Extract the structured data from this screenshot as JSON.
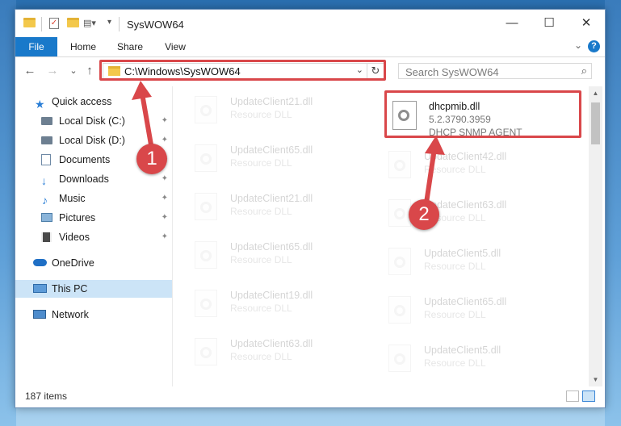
{
  "window": {
    "title": "SysWOW64",
    "minimize": "—",
    "maximize": "☐",
    "close": "✕"
  },
  "ribbon": {
    "tabs": [
      "File",
      "Home",
      "Share",
      "View"
    ],
    "collapse": "⌄",
    "help": "?"
  },
  "nav": {
    "back": "←",
    "forward": "→",
    "recent": "⌄",
    "up": "↑",
    "address": "C:\\Windows\\SysWOW64",
    "refresh": "↻",
    "search_placeholder": "Search SysWOW64"
  },
  "sidebar": {
    "items": [
      {
        "label": "Quick access",
        "icon": "star-icon",
        "pinned": false
      },
      {
        "label": "Local Disk (C:)",
        "icon": "drive-icon",
        "pinned": true
      },
      {
        "label": "Local Disk (D:)",
        "icon": "drive-icon",
        "pinned": true
      },
      {
        "label": "Documents",
        "icon": "documents-icon",
        "pinned": true
      },
      {
        "label": "Downloads",
        "icon": "download-icon",
        "pinned": true
      },
      {
        "label": "Music",
        "icon": "music-icon",
        "pinned": true
      },
      {
        "label": "Pictures",
        "icon": "pictures-icon",
        "pinned": true
      },
      {
        "label": "Videos",
        "icon": "videos-icon",
        "pinned": true
      },
      {
        "label": "OneDrive",
        "icon": "cloud-icon",
        "pinned": false
      },
      {
        "label": "This PC",
        "icon": "computer-icon",
        "pinned": false
      },
      {
        "label": "Network",
        "icon": "network-icon",
        "pinned": false
      }
    ],
    "pin_glyph": "📌"
  },
  "files": {
    "highlighted": {
      "name": "dhcpmib.dll",
      "version": "5.2.3790.3959",
      "description": "DHCP SNMP AGENT"
    },
    "left": [
      {
        "name": "UpdateClient21.dll",
        "description": "Resource DLL"
      },
      {
        "name": "UpdateClient65.dll",
        "description": "Resource DLL"
      },
      {
        "name": "UpdateClient21.dll",
        "description": "Resource DLL"
      },
      {
        "name": "UpdateClient65.dll",
        "description": "Resource DLL"
      },
      {
        "name": "UpdateClient19.dll",
        "description": "Resource DLL"
      },
      {
        "name": "UpdateClient63.dll",
        "description": "Resource DLL"
      }
    ],
    "right": [
      {
        "name": "UpdateClient42.dll",
        "description": "Resource DLL"
      },
      {
        "name": "UpdateClient63.dll",
        "description": "Resource DLL"
      },
      {
        "name": "UpdateClient5.dll",
        "description": "Resource DLL"
      },
      {
        "name": "UpdateClient65.dll",
        "description": "Resource DLL"
      },
      {
        "name": "UpdateClient5.dll",
        "description": "Resource DLL"
      }
    ]
  },
  "status": {
    "items_count": "187 items"
  },
  "annotations": {
    "badge1": "1",
    "badge2": "2",
    "color": "#d9474a"
  }
}
